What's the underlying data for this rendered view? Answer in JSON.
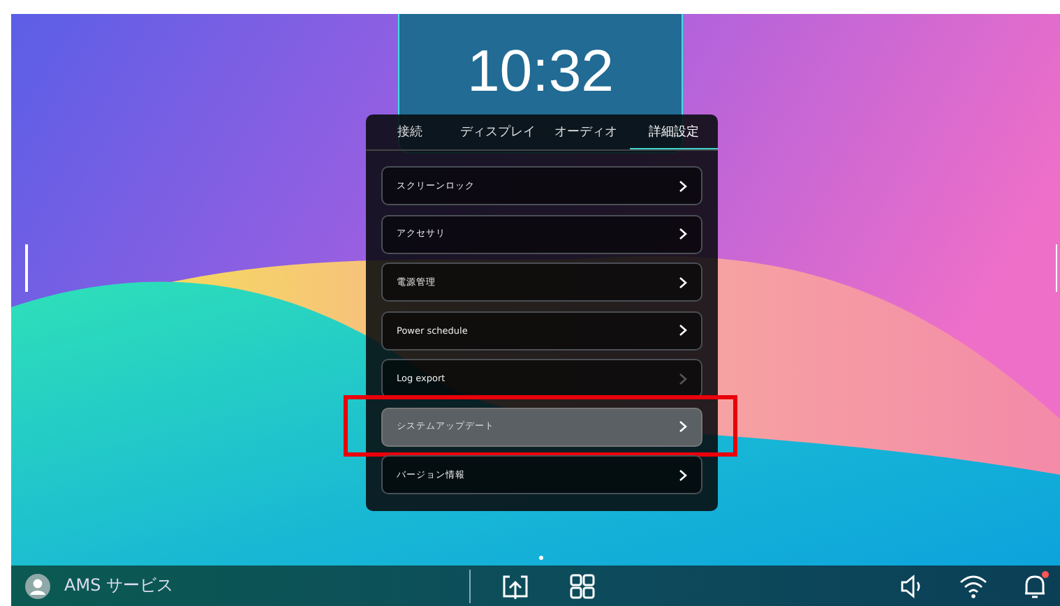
{
  "clock": {
    "time": "10:32"
  },
  "settings_panel": {
    "tabs": [
      {
        "label": "接続",
        "selected": false
      },
      {
        "label": "ディスプレイ",
        "selected": false
      },
      {
        "label": "オーディオ",
        "selected": false
      },
      {
        "label": "詳細設定",
        "selected": true
      }
    ],
    "items": [
      {
        "label": "スクリーンロック",
        "selected": false,
        "disabled": false,
        "highlighted": false
      },
      {
        "label": "アクセサリ",
        "selected": false,
        "disabled": false,
        "highlighted": false
      },
      {
        "label": "電源管理",
        "selected": false,
        "disabled": false,
        "highlighted": false
      },
      {
        "label": "Power schedule",
        "selected": false,
        "disabled": false,
        "highlighted": false
      },
      {
        "label": "Log export",
        "selected": false,
        "disabled": true,
        "highlighted": false
      },
      {
        "label": "システムアップデート",
        "selected": true,
        "disabled": false,
        "highlighted": true
      },
      {
        "label": "バージョン情報",
        "selected": false,
        "disabled": false,
        "highlighted": false
      }
    ]
  },
  "taskbar": {
    "user": "AMS サービス",
    "notification_badge": true
  }
}
